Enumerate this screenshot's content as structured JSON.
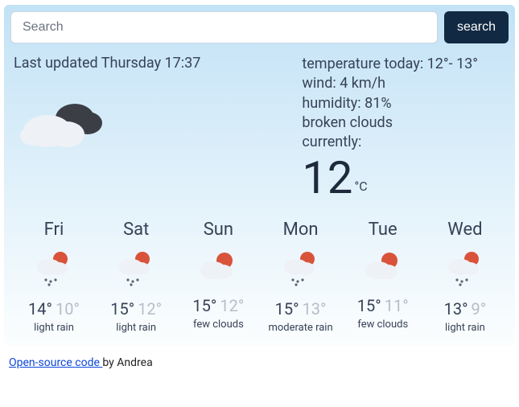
{
  "search": {
    "placeholder": "Search",
    "button_label": "search"
  },
  "header": {
    "last_updated": "Last updated Thursday 17:37"
  },
  "current": {
    "lines": [
      "temperature today: 12°- 13°",
      "wind: 4 km/h",
      "humidity: 81%",
      "broken clouds",
      "currently:"
    ],
    "temp": "12",
    "unit": "°C"
  },
  "forecast": [
    {
      "day": "Fri",
      "hi": "14°",
      "lo": "10°",
      "desc": "light rain",
      "icon": "rain-sun"
    },
    {
      "day": "Sat",
      "hi": "15°",
      "lo": "12°",
      "desc": "light rain",
      "icon": "rain-sun"
    },
    {
      "day": "Sun",
      "hi": "15°",
      "lo": "12°",
      "desc": "few clouds",
      "icon": "cloud-sun"
    },
    {
      "day": "Mon",
      "hi": "15°",
      "lo": "13°",
      "desc": "moderate rain",
      "icon": "rain-sun"
    },
    {
      "day": "Tue",
      "hi": "15°",
      "lo": "11°",
      "desc": "few clouds",
      "icon": "cloud-sun"
    },
    {
      "day": "Wed",
      "hi": "13°",
      "lo": "9°",
      "desc": "light rain",
      "icon": "rain-sun"
    }
  ],
  "footer": {
    "link_text": "Open-source code ",
    "by_text": "by Andrea"
  }
}
